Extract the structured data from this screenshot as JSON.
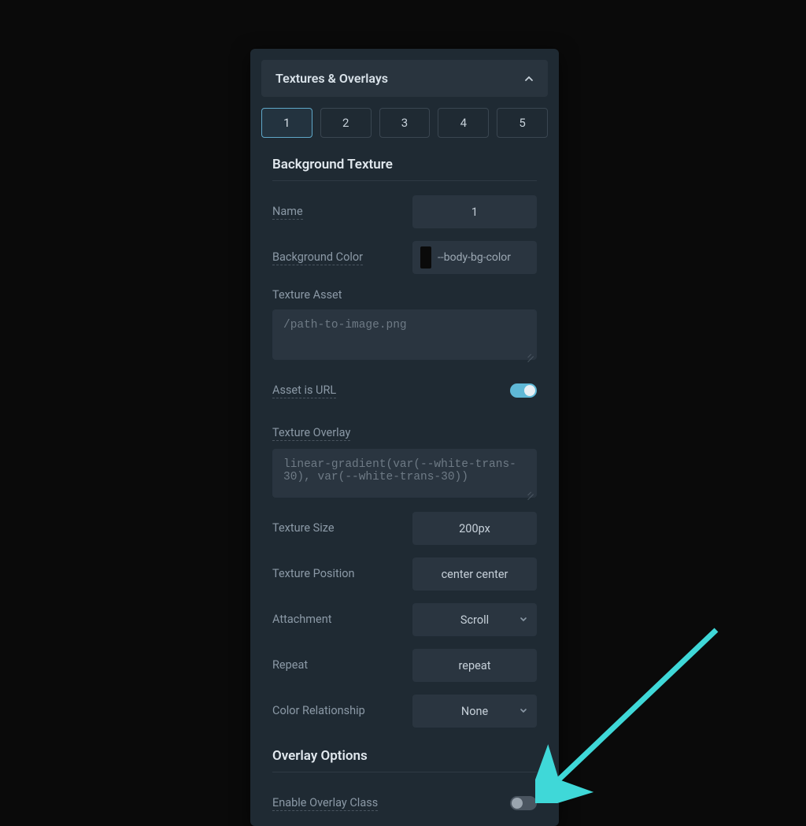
{
  "header": {
    "title": "Textures & Overlays"
  },
  "tabs": [
    "1",
    "2",
    "3",
    "4",
    "5"
  ],
  "active_tab_index": 0,
  "sections": {
    "bg_texture": {
      "title": "Background Texture",
      "name_label": "Name",
      "name_value": "1",
      "bgcolor_label": "Background Color",
      "bgcolor_value": "--body-bg-color",
      "asset_label": "Texture Asset",
      "asset_placeholder": "/path-to-image.png",
      "asset_url_label": "Asset is URL",
      "asset_url_on": true,
      "overlay_label": "Texture Overlay",
      "overlay_placeholder": "linear-gradient(var(--white-trans-30), var(--white-trans-30))",
      "size_label": "Texture Size",
      "size_value": "200px",
      "position_label": "Texture Position",
      "position_value": "center center",
      "attachment_label": "Attachment",
      "attachment_value": "Scroll",
      "repeat_label": "Repeat",
      "repeat_value": "repeat",
      "color_rel_label": "Color Relationship",
      "color_rel_value": "None"
    },
    "overlay_options": {
      "title": "Overlay Options",
      "enable_label": "Enable Overlay Class",
      "enable_on": false
    }
  }
}
